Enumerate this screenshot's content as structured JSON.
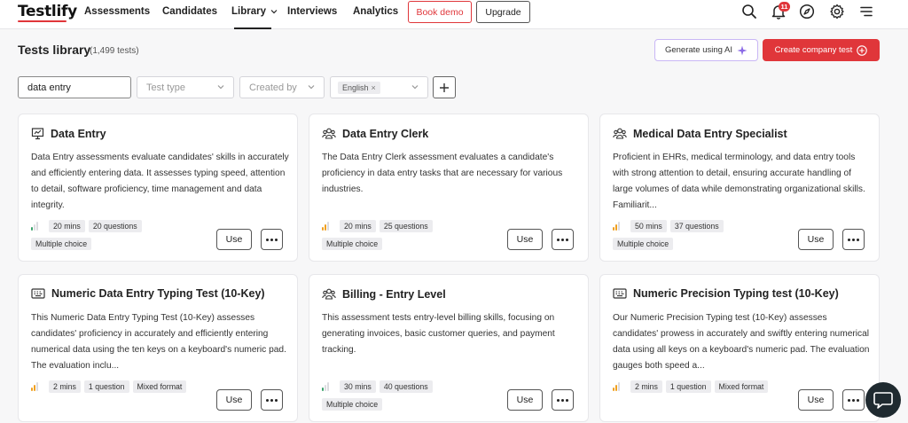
{
  "app": {
    "logo": "Testlify"
  },
  "nav": {
    "items": [
      {
        "label": "Assessments"
      },
      {
        "label": "Candidates"
      },
      {
        "label": "Library"
      },
      {
        "label": "Interviews"
      },
      {
        "label": "Analytics"
      }
    ],
    "active": "Library",
    "book_demo": "Book demo",
    "upgrade": "Upgrade",
    "notification_count": "11",
    "icons": [
      "search-icon",
      "bell-icon",
      "compass-icon",
      "gear-icon",
      "menu-icon"
    ]
  },
  "header": {
    "title": "Tests library",
    "count": "(1,499 tests)",
    "generate_ai": "Generate using AI",
    "create_test": "Create company test"
  },
  "filters": {
    "search_value": "data entry",
    "test_type_placeholder": "Test type",
    "created_by_placeholder": "Created by",
    "language_chip": "English"
  },
  "colors": {
    "accent": "#e0363a",
    "level_orange": "#f0a020",
    "level_green": "#3aa36b"
  },
  "cards": [
    {
      "title": "Data Entry",
      "icon": "presentation-icon",
      "description": "Data Entry assessments evaluate candidates' skills in accurately and efficiently entering data. It assesses typing speed, attention to detail, software proficiency, time management and data integrity.",
      "level": "green",
      "duration": "20 mins",
      "questions": "20 questions",
      "format": "Multiple choice",
      "use_label": "Use"
    },
    {
      "title": "Data Entry Clerk",
      "icon": "team-icon",
      "description": "The Data Entry Clerk assessment evaluates a candidate's proficiency in data entry tasks that are necessary for various industries.",
      "level": "orange",
      "duration": "20 mins",
      "questions": "25 questions",
      "format": "Multiple choice",
      "use_label": "Use"
    },
    {
      "title": "Medical Data Entry Specialist",
      "icon": "team-icon",
      "description": "Proficient in EHRs, medical terminology, and data entry tools with strong attention to detail, ensuring accurate handling of large volumes of data while demonstrating organizational skills. Familiarit...",
      "level": "orange",
      "duration": "50 mins",
      "questions": "37 questions",
      "format": "Multiple choice",
      "use_label": "Use"
    },
    {
      "title": "Numeric Data Entry Typing Test (10-Key)",
      "icon": "keyboard-icon",
      "description": "This Numeric Data Entry Typing Test (10-Key) assesses candidates' proficiency in accurately and efficiently entering numerical data using the ten keys on a keyboard's numeric pad. The evaluation inclu...",
      "level": "orange",
      "duration": "2 mins",
      "questions": "1 question",
      "format": "Mixed format",
      "use_label": "Use"
    },
    {
      "title": "Billing - Entry Level",
      "icon": "team-icon",
      "description": "This assessment tests entry-level billing skills, focusing on generating invoices, basic customer queries, and payment tracking.",
      "level": "green",
      "duration": "30 mins",
      "questions": "40 questions",
      "format": "Multiple choice",
      "use_label": "Use"
    },
    {
      "title": "Numeric Precision Typing test (10-Key)",
      "icon": "keyboard-icon",
      "description": "Our Numeric Precision Typing test (10-Key) assesses candidates' prowess in accurately and swiftly entering numerical data using all keys on a keyboard's numeric pad. The evaluation gauges both speed a...",
      "level": "orange",
      "duration": "2 mins",
      "questions": "1 question",
      "format": "Mixed format",
      "use_label": "Use"
    }
  ]
}
